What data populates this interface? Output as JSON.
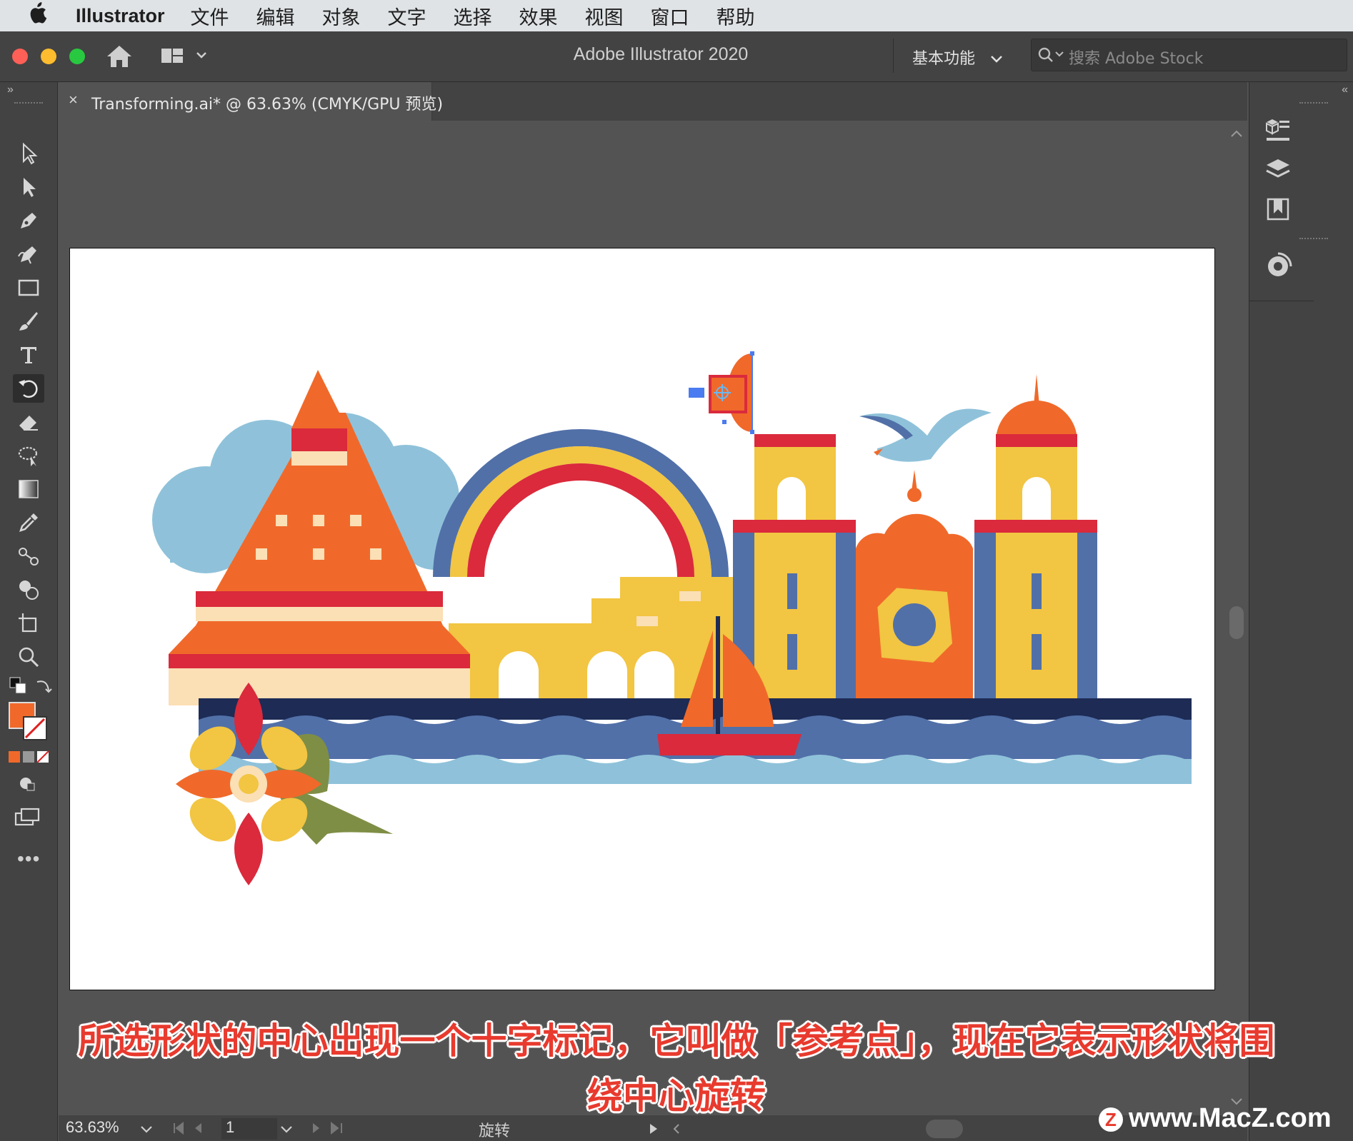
{
  "menubar": {
    "app_name": "Illustrator",
    "items": [
      "文件",
      "编辑",
      "对象",
      "文字",
      "选择",
      "效果",
      "视图",
      "窗口",
      "帮助"
    ]
  },
  "titlebar": {
    "title": "Adobe Illustrator 2020",
    "workspace": "基本功能",
    "search_placeholder": "搜索 Adobe Stock"
  },
  "tab": {
    "close": "×",
    "label": "Transforming.ai* @ 63.63% (CMYK/GPU 预览)"
  },
  "status": {
    "zoom": "63.63%",
    "page": "1",
    "tool_name": "旋转"
  },
  "subtitle": {
    "line1": "所选形状的中心出现一个十字标记，它叫做「参考点」，现在它表示形状将围",
    "line2": "绕中心旋转"
  },
  "watermark": "www.MacZ.com",
  "colors": {
    "orange": "#f0692a",
    "red": "#da2a3c",
    "yellow": "#f2c542",
    "blue": "#5170a8",
    "lightblue": "#8fc2da",
    "navy": "#1d2b55",
    "cream": "#fbdfb5",
    "olive": "#7f8e45"
  },
  "tools": [
    "selection-tool-icon",
    "direct-selection-tool-icon",
    "pen-tool-icon",
    "curvature-tool-icon",
    "rectangle-tool-icon",
    "paintbrush-tool-icon",
    "type-tool-icon",
    "rotate-tool-icon",
    "eraser-tool-icon",
    "lasso-tool-icon",
    "gradient-tool-icon",
    "eyedropper-tool-icon",
    "blend-tool-icon",
    "shape-builder-tool-icon",
    "artboard-tool-icon",
    "zoom-tool-icon"
  ]
}
